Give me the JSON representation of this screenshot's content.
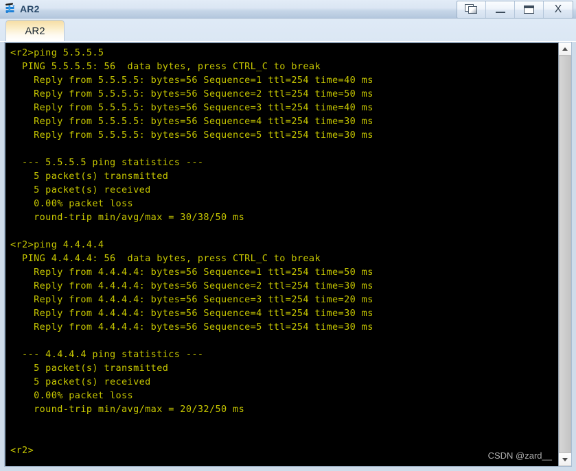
{
  "window": {
    "title": "AR2",
    "icon": "router-icon",
    "controls": [
      {
        "name": "restore-button",
        "label": ""
      },
      {
        "name": "minimize-button",
        "label": ""
      },
      {
        "name": "maximize-button",
        "label": ""
      },
      {
        "name": "close-button",
        "label": "X"
      }
    ]
  },
  "tabs": [
    {
      "label": "AR2",
      "active": true
    }
  ],
  "terminal": {
    "watermark": "CSDN @zard__",
    "prompt": "<r2>",
    "text_color": "#c8c800",
    "background_color": "#000000",
    "lines": [
      "<r2>ping 5.5.5.5",
      "  PING 5.5.5.5: 56  data bytes, press CTRL_C to break",
      "    Reply from 5.5.5.5: bytes=56 Sequence=1 ttl=254 time=40 ms",
      "    Reply from 5.5.5.5: bytes=56 Sequence=2 ttl=254 time=50 ms",
      "    Reply from 5.5.5.5: bytes=56 Sequence=3 ttl=254 time=40 ms",
      "    Reply from 5.5.5.5: bytes=56 Sequence=4 ttl=254 time=30 ms",
      "    Reply from 5.5.5.5: bytes=56 Sequence=5 ttl=254 time=30 ms",
      "",
      "  --- 5.5.5.5 ping statistics ---",
      "    5 packet(s) transmitted",
      "    5 packet(s) received",
      "    0.00% packet loss",
      "    round-trip min/avg/max = 30/38/50 ms",
      "",
      "<r2>ping 4.4.4.4",
      "  PING 4.4.4.4: 56  data bytes, press CTRL_C to break",
      "    Reply from 4.4.4.4: bytes=56 Sequence=1 ttl=254 time=50 ms",
      "    Reply from 4.4.4.4: bytes=56 Sequence=2 ttl=254 time=30 ms",
      "    Reply from 4.4.4.4: bytes=56 Sequence=3 ttl=254 time=20 ms",
      "    Reply from 4.4.4.4: bytes=56 Sequence=4 ttl=254 time=30 ms",
      "    Reply from 4.4.4.4: bytes=56 Sequence=5 ttl=254 time=30 ms",
      "",
      "  --- 4.4.4.4 ping statistics ---",
      "    5 packet(s) transmitted",
      "    5 packet(s) received",
      "    0.00% packet loss",
      "    round-trip min/avg/max = 20/32/50 ms",
      "",
      "",
      "<r2>"
    ]
  },
  "scrollbar": {
    "up_arrow": "chevron-up-icon",
    "down_arrow": "chevron-down-icon"
  }
}
